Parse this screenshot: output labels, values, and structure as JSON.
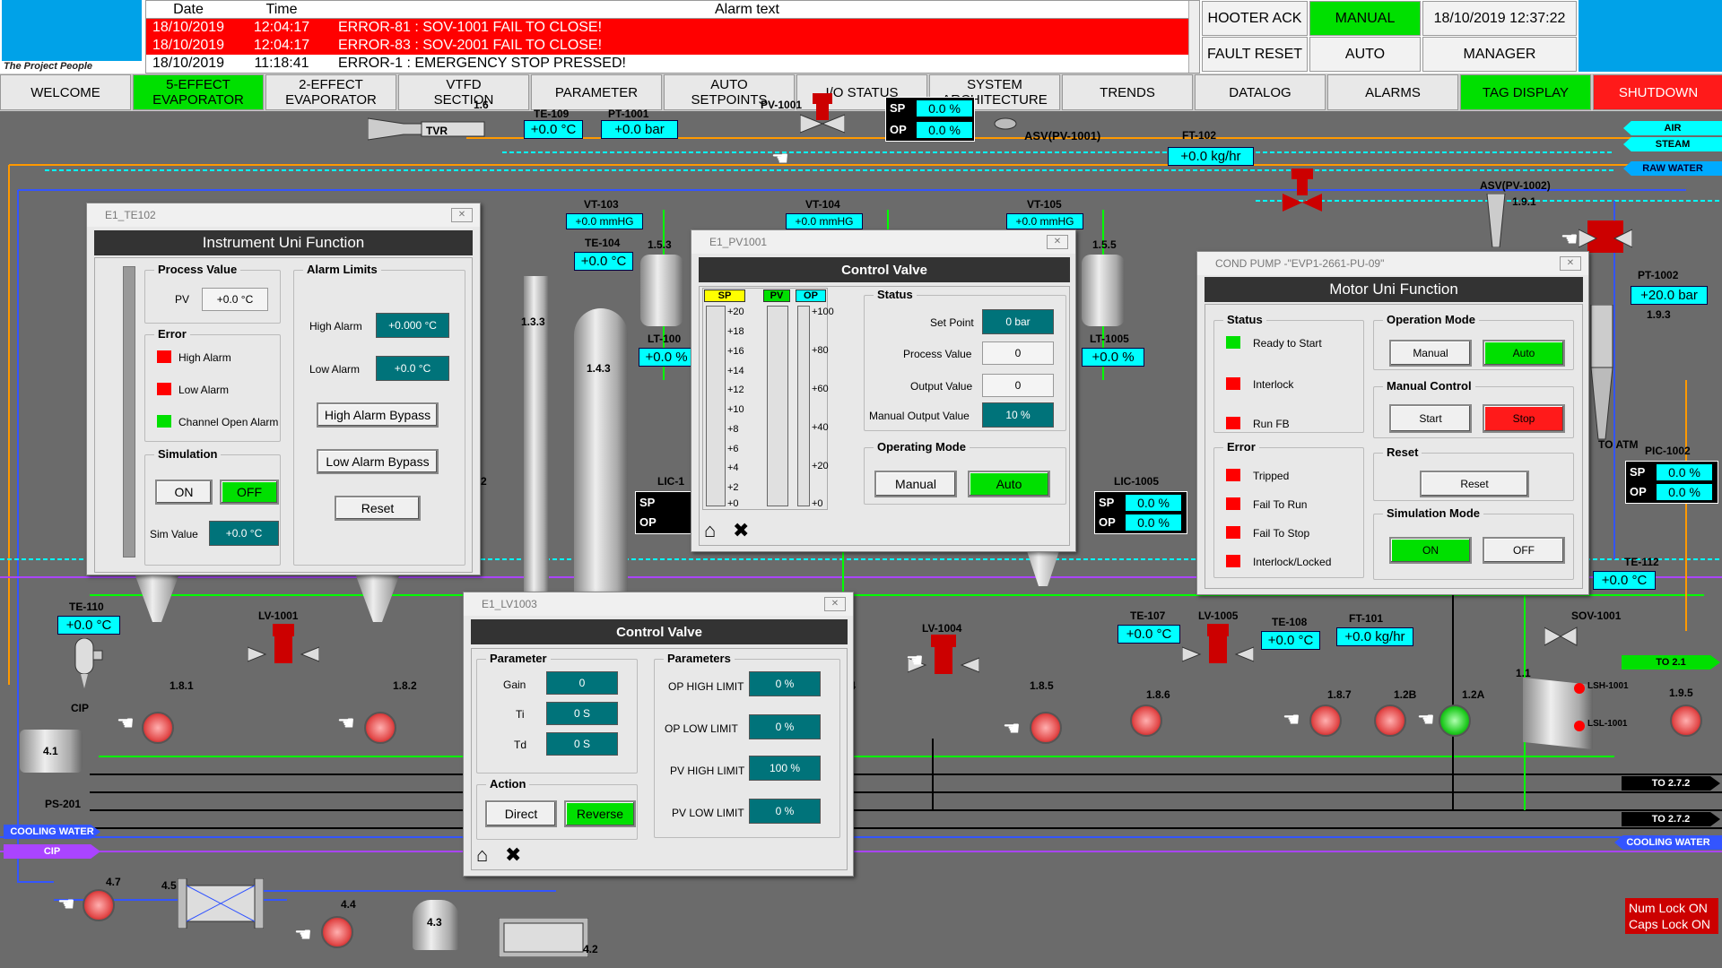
{
  "header": {
    "logo_tagline": "The Project  People",
    "alarm_table": {
      "columns": [
        "Date",
        "Time",
        "Alarm text"
      ],
      "rows": [
        {
          "date": "18/10/2019",
          "time": "12:04:17",
          "text": "ERROR-81 : SOV-1001 FAIL TO CLOSE!",
          "color": "#ff0000"
        },
        {
          "date": "18/10/2019",
          "time": "12:04:17",
          "text": "ERROR-83 : SOV-2001 FAIL TO CLOSE!",
          "color": "#ff0000"
        },
        {
          "date": "18/10/2019",
          "time": "11:18:41",
          "text": "EMERGENCY STOP PRESSED!",
          "text_prefix": "ERROR-1 : ",
          "color": "#ffffff"
        }
      ]
    },
    "hooter_ack": "HOOTER ACK",
    "fault_reset": "FAULT RESET",
    "manual": "MANUAL",
    "auto": "AUTO",
    "datetime": "18/10/2019 12:37:22",
    "manager": "MANAGER"
  },
  "nav": [
    {
      "label": "WELCOME",
      "color": "#e8e8e8"
    },
    {
      "label": "5-EFFECT\nEVAPORATOR",
      "color": "#00e000"
    },
    {
      "label": "2-EFFECT\nEVAPORATOR",
      "color": "#e8e8e8"
    },
    {
      "label": "VTFD\nSECTION",
      "color": "#e8e8e8"
    },
    {
      "label": "PARAMETER",
      "color": "#e8e8e8"
    },
    {
      "label": "AUTO\nSETPOINTS",
      "color": "#e8e8e8"
    },
    {
      "label": "I/O STATUS",
      "color": "#e8e8e8"
    },
    {
      "label": "SYSTEM\nARCHITECTURE",
      "color": "#e8e8e8"
    },
    {
      "label": "TRENDS",
      "color": "#e8e8e8"
    },
    {
      "label": "DATALOG",
      "color": "#e8e8e8"
    },
    {
      "label": "ALARMS",
      "color": "#e8e8e8"
    },
    {
      "label": "TAG DISPLAY",
      "color": "#00e000"
    },
    {
      "label": "SHUTDOWN",
      "color": "#ff1a1a"
    }
  ],
  "process": {
    "tags": {
      "te109": "TE-109",
      "te109_val": "+0.0 °C",
      "pt1001": "PT-1001",
      "pt1001_val": "+0.0 bar",
      "pv1001": "PV-1001",
      "asv1001": "ASV(PV-1001)",
      "ft102": "FT-102",
      "ft102_val": "+0.0 kg/hr",
      "air": "AIR",
      "steam": "STEAM",
      "raw_water": "RAW WATER",
      "tvr": "TVR",
      "n16": "1.6",
      "vt103": "VT-103",
      "vt103_val": "+0.0 mmHG",
      "vt104": "VT-104",
      "vt104_val": "+0.0 mmHG",
      "vt105": "VT-105",
      "vt105_val": "+0.0 mmHG",
      "te104": "TE-104",
      "te104_val": "+0.0 °C",
      "n153": "1.5.3",
      "n155": "1.5.5",
      "lt100": "LT-100",
      "lt1005": "LT-1005",
      "lt1005_val": "+0.0 %",
      "lt100_val": "+0.0 %",
      "n133": "1.3.3",
      "n143": "1.4.3",
      "asv1002": "ASV(PV-1002)",
      "n191": "1.9.1",
      "pt1002": "PT-1002",
      "pt1002_val": "+20.0 bar",
      "n193": "1.9.3",
      "to_atm": "TO ATM",
      "pic1002": "PIC-1002",
      "pic_sp": "0.0 %",
      "pic_op": "0.0 %",
      "lic1005": "LIC-1005",
      "lic_sp": "0.0 %",
      "lic_op": "0.0 %",
      "lic1": "LIC-1",
      "te112": "TE-112",
      "te112_val": "+0.0 °C",
      "te110": "TE-110",
      "te110_val": "+0.0 °C",
      "cip": "CIP",
      "lv1001": "LV-1001",
      "lv1004": "LV-1004",
      "lv1005": "LV-1005",
      "te107": "TE-107",
      "te107_val": "+0.0 °C",
      "te108": "TE-108",
      "te108_val": "+0.0 °C",
      "ft101": "FT-101",
      "ft101_val": "+0.0 kg/hr",
      "sov1001": "SOV-1001",
      "to21": "TO 2.1",
      "n181": "1.8.1",
      "n182": "1.8.2",
      "n185": "1.8.5",
      "n186": "1.8.6",
      "n187": "1.8.7",
      "n128": "1.2B",
      "n12a": "1.2A",
      "n11": "1.1",
      "n195": "1.9.5",
      "n4": ".4",
      "lsh1001": "LSH-1001",
      "lsl1001": "LSL-1001",
      "to272a": "TO 2.7.2",
      "to272b": "TO 2.7.2",
      "cooling_water": "COOLING WATER",
      "n41": "4.1",
      "ps201": "PS-201",
      "n47": "4.7",
      "n45": "4.5",
      "n44": "4.4",
      "n43": "4.3",
      "n42": "4.2",
      "pv_sp": "0.0 %",
      "pv_op": "0.0 %",
      "te102_partial": "2"
    },
    "numlock": "Num Lock ON",
    "capslock": "Caps Lock ON"
  },
  "win_te102": {
    "titlebar": "E1_TE102",
    "title": "Instrument Uni Function",
    "process_value": "Process Value",
    "pv_label": "PV",
    "pv_value": "+0.0 °C",
    "alarm_limits": "Alarm Limits",
    "high_alarm": "High Alarm",
    "high_alarm_val": "+0.000 °C",
    "low_alarm": "Low Alarm",
    "low_alarm_val": "+0.0 °C",
    "high_bypass": "High Alarm Bypass",
    "low_bypass": "Low Alarm Bypass",
    "reset": "Reset",
    "error": "Error",
    "err_high": "High Alarm",
    "err_low": "Low Alarm",
    "err_open": "Channel Open Alarm",
    "simulation": "Simulation",
    "on": "ON",
    "off": "OFF",
    "sim_value": "Sim Value",
    "sim_value_val": "+0.0 °C"
  },
  "win_pv1001": {
    "titlebar": "E1_PV1001",
    "title": "Control Valve",
    "sp": "SP",
    "pv": "PV",
    "op": "OP",
    "left_scale": [
      "+20",
      "+18",
      "+16",
      "+14",
      "+12",
      "+10",
      "+8",
      "+6",
      "+4",
      "+2",
      "+0"
    ],
    "right_scale": [
      "+100",
      "+80",
      "+60",
      "+40",
      "+20",
      "+0"
    ],
    "status": "Status",
    "set_point": "Set Point",
    "set_point_val": "0 bar",
    "process_value": "Process Value",
    "process_value_val": "0",
    "output_value": "Output Value",
    "output_value_val": "0",
    "manual_output": "Manual Output Value",
    "manual_output_val": "10 %",
    "operating_mode": "Operating Mode",
    "manual": "Manual",
    "auto": "Auto"
  },
  "win_lv1003": {
    "titlebar": "E1_LV1003",
    "title": "Control Valve",
    "parameter": "Parameter",
    "gain": "Gain",
    "gain_val": "0",
    "ti": "Ti",
    "ti_val": "0 S",
    "td": "Td",
    "td_val": "0 S",
    "parameters": "Parameters",
    "op_high": "OP HIGH LIMIT",
    "op_high_val": "0 %",
    "op_low": "OP LOW  LIMIT",
    "op_low_val": "0 %",
    "pv_high": "PV HIGH LIMIT",
    "pv_high_val": "100 %",
    "pv_low": "PV LOW LIMIT",
    "pv_low_val": "0 %",
    "action": "Action",
    "direct": "Direct",
    "reverse": "Reverse"
  },
  "win_pump": {
    "titlebar": "COND PUMP -\"EVP1-2661-PU-09\"",
    "title": "Motor Uni Function",
    "status": "Status",
    "ready": "Ready to Start",
    "interlock": "Interlock",
    "run_fb": "Run FB",
    "operation_mode": "Operation Mode",
    "manual": "Manual",
    "auto": "Auto",
    "manual_control": "Manual Control",
    "start": "Start",
    "stop": "Stop",
    "error": "Error",
    "tripped": "Tripped",
    "fail_run": "Fail To Run",
    "fail_stop": "Fail To Stop",
    "interlock_locked": "Interlock/Locked",
    "reset_grp": "Reset",
    "reset": "Reset",
    "simulation_mode": "Simulation Mode",
    "on": "ON",
    "off": "OFF"
  }
}
